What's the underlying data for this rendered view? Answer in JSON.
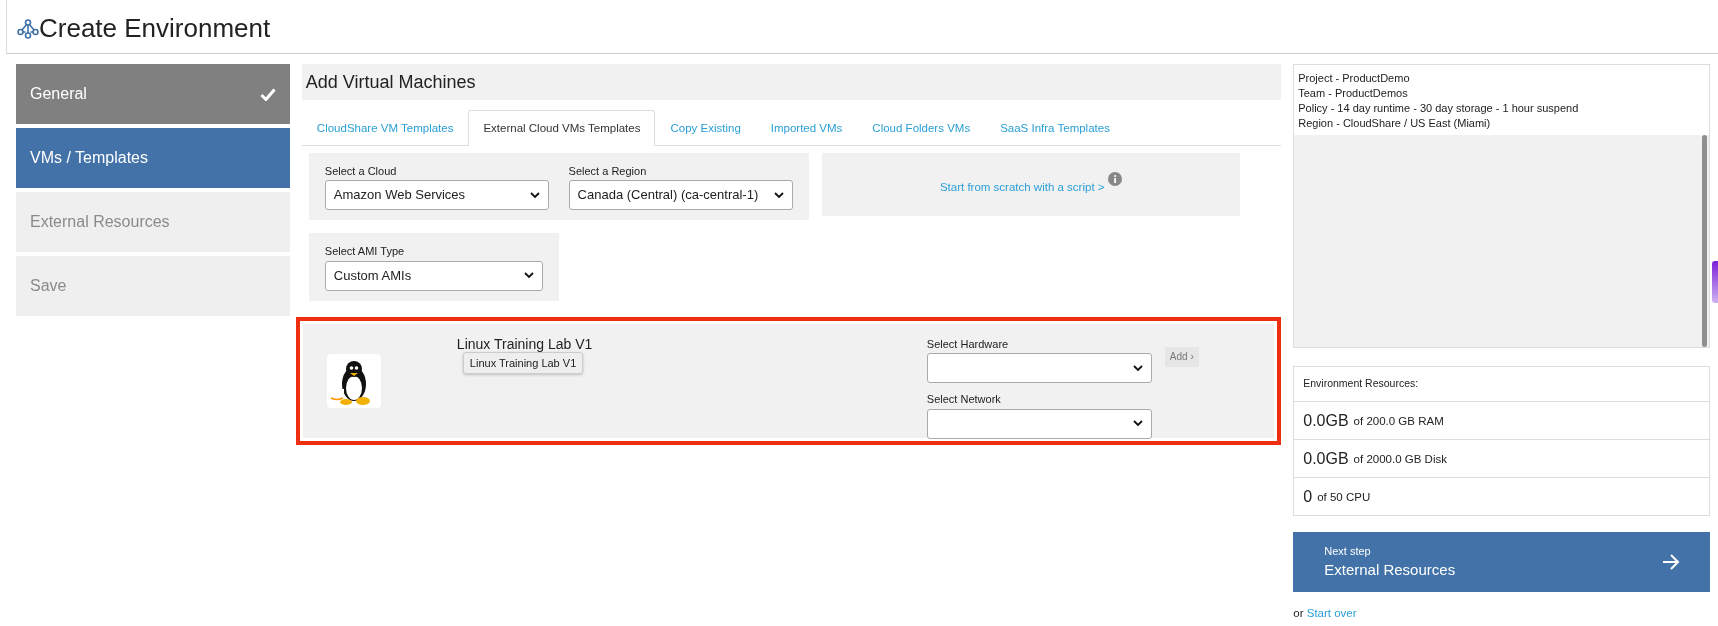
{
  "page": {
    "title": "Create Environment"
  },
  "steps": [
    {
      "label": "General",
      "selected": false,
      "completed": true,
      "disabled": false
    },
    {
      "label": "VMs / Templates",
      "selected": true,
      "completed": false,
      "disabled": false
    },
    {
      "label": "External Resources",
      "selected": false,
      "completed": false,
      "disabled": true
    },
    {
      "label": "Save",
      "selected": false,
      "completed": false,
      "disabled": true
    }
  ],
  "section_title": "Add Virtual Machines",
  "tabs": [
    {
      "label": "CloudShare VM Templates",
      "selected": false
    },
    {
      "label": "External Cloud VMs Templates",
      "selected": true
    },
    {
      "label": "Copy Existing",
      "selected": false
    },
    {
      "label": "Imported VMs",
      "selected": false
    },
    {
      "label": "Cloud Folders VMs",
      "selected": false
    },
    {
      "label": "SaaS Infra Templates",
      "selected": false
    }
  ],
  "cloud_select": {
    "label": "Select a Cloud",
    "value": "Amazon Web Services"
  },
  "region_select": {
    "label": "Select a Region",
    "value": "Canada (Central) (ca-central-1)"
  },
  "script_link": "Start from scratch with a script >",
  "ami_select": {
    "label": "Select AMI Type",
    "value": "Custom AMIs"
  },
  "vm": {
    "name": "Linux Training Lab V1",
    "tooltip": "Linux Training Lab V1",
    "highlighted": true,
    "hardware": {
      "label": "Select Hardware"
    },
    "network": {
      "label": "Select Network"
    },
    "add_button": {
      "label": "Add ›",
      "disabled": true
    }
  },
  "info": [
    "Project - ProductDemo",
    "Team - ProductDemos",
    "Policy - 14 day runtime - 30 day storage - 1 hour suspend",
    "Region - CloudShare / US East (Miami)"
  ],
  "resources": {
    "title": "Environment Resources:",
    "rows": [
      {
        "amount": "0.0GB",
        "limit": "of 200.0 GB RAM"
      },
      {
        "amount": "0.0GB",
        "limit": "of 2000.0 GB Disk"
      },
      {
        "amount": "0",
        "limit": "of 50 CPU"
      }
    ]
  },
  "next_step": {
    "caption": "Next step",
    "label": "External Resources"
  },
  "start_over": {
    "prefix": "or",
    "link": "Start over"
  }
}
